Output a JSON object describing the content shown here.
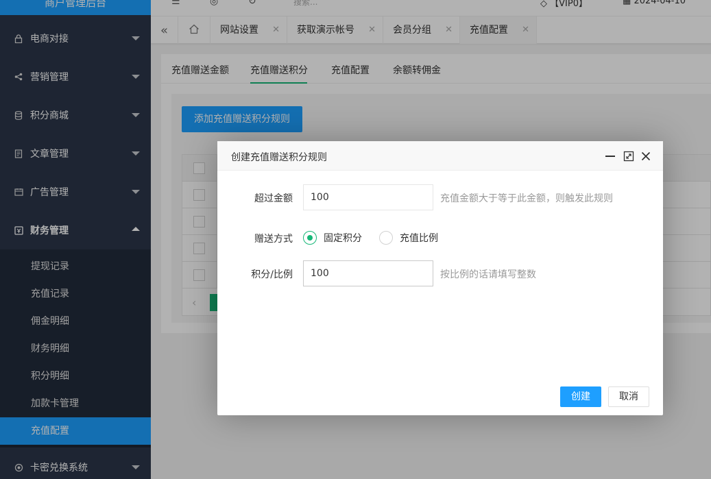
{
  "app": {
    "logo_text": "商户管理后台"
  },
  "topbar": {
    "search_placeholder": "搜索...",
    "vip_label": "【VIP0】",
    "date": "2024-04-10"
  },
  "sidebar": {
    "items": [
      {
        "label": "电商对接",
        "icon": "lock-icon"
      },
      {
        "label": "营销管理",
        "icon": "share-icon"
      },
      {
        "label": "积分商城",
        "icon": "database-icon"
      },
      {
        "label": "文章管理",
        "icon": "document-icon"
      },
      {
        "label": "广告管理",
        "icon": "calendar-icon"
      },
      {
        "label": "财务管理",
        "icon": "finance-icon",
        "expanded": true
      },
      {
        "label": "卡密兑换系统",
        "icon": "settings-icon"
      }
    ],
    "submenu": [
      {
        "label": "提现记录"
      },
      {
        "label": "充值记录"
      },
      {
        "label": "佣金明细"
      },
      {
        "label": "财务明细"
      },
      {
        "label": "积分明细"
      },
      {
        "label": "加款卡管理"
      },
      {
        "label": "充值配置",
        "active": true
      }
    ]
  },
  "tabs": [
    {
      "label": "网站设置"
    },
    {
      "label": "获取演示帐号"
    },
    {
      "label": "会员分组"
    },
    {
      "label": "充值配置",
      "active": true
    }
  ],
  "content": {
    "subtabs": [
      "充值赠送金额",
      "充值赠送积分",
      "充值配置",
      "余额转佣金"
    ],
    "active_subtab": "充值赠送积分",
    "add_button": "添加充值赠送积分规则"
  },
  "dialog": {
    "title": "创建充值赠送积分规则",
    "fields": {
      "amount": {
        "label": "超过金额",
        "value": "100",
        "hint": "充值金额大于等于此金额，则触发此规则"
      },
      "mode": {
        "label": "赠送方式",
        "options": [
          "固定积分",
          "充值比例"
        ],
        "selected": "固定积分"
      },
      "points": {
        "label": "积分/比例",
        "value": "100",
        "hint": "按比例的话请填写整数"
      }
    },
    "buttons": {
      "create": "创建",
      "cancel": "取消"
    }
  },
  "colors": {
    "primary": "#1e9fff",
    "green": "#16b777",
    "sidebar": "#2b3649"
  }
}
